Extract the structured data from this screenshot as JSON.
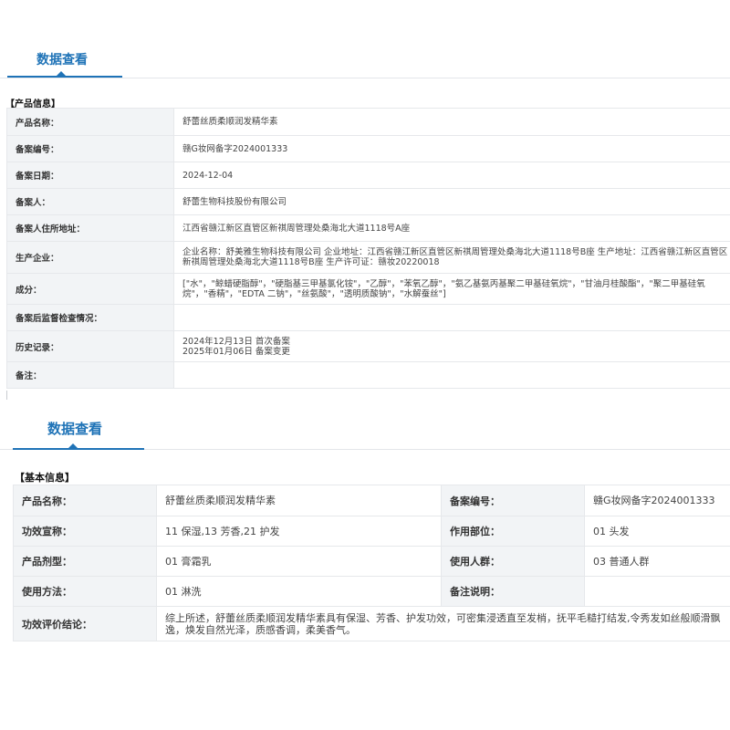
{
  "panel1": {
    "tab_label": "数据查看",
    "section_title": "【产品信息】",
    "rows": [
      {
        "label": "产品名称：",
        "value": "舒蕾丝质柔顺润发精华素"
      },
      {
        "label": "备案编号：",
        "value": "赣G妆网备字2024001333"
      },
      {
        "label": "备案日期：",
        "value": "2024-12-04"
      },
      {
        "label": "备案人：",
        "value": "舒蕾生物科技股份有限公司"
      },
      {
        "label": "备案人住所地址：",
        "value": "江西省赣江新区直管区新祺周管理处桑海北大道1118号A座"
      },
      {
        "label": "生产企业：",
        "value": "企业名称：舒美雅生物科技有限公司 企业地址：江西省赣江新区直管区新祺周管理处桑海北大道1118号B座 生产地址：江西省赣江新区直管区新祺周管理处桑海北大道1118号B座 生产许可证：赣妆20220018"
      },
      {
        "label": "成分：",
        "value": "[\"水\"，\"鲸蜡硬脂醇\"，\"硬脂基三甲基氯化铵\"，\"乙醇\"，\"苯氧乙醇\"，\"氨乙基氨丙基聚二甲基硅氧烷\"，\"甘油月桂酸酯\"，\"聚二甲基硅氧烷\"，\"香精\"，\"EDTA 二钠\"，\"丝氨酸\"，\"透明质酸钠\"，\"水解蚕丝\"]"
      },
      {
        "label": "备案后监督检查情况：",
        "value": ""
      },
      {
        "label": "历史记录：",
        "value_lines": [
          "2024年12月13日 首次备案",
          "2025年01月06日 备案变更"
        ]
      },
      {
        "label": "备注：",
        "value": ""
      }
    ]
  },
  "panel2": {
    "tab_label": "数据查看",
    "section_title": "【基本信息】",
    "rows": [
      {
        "label1": "产品名称：",
        "value1": "舒蕾丝质柔顺润发精华素",
        "label2": "备案编号：",
        "value2": "赣G妆网备字2024001333"
      },
      {
        "label1": "功效宣称：",
        "value1": "11 保湿,13 芳香,21 护发",
        "label2": "作用部位：",
        "value2": "01 头发"
      },
      {
        "label1": "产品剂型：",
        "value1": "01 膏霜乳",
        "label2": "使用人群：",
        "value2": "03 普通人群"
      },
      {
        "label1": "使用方法：",
        "value1": "01 淋洗",
        "label2": "备注说明：",
        "value2": ""
      }
    ],
    "conclusion_label": "功效评价结论：",
    "conclusion_value": "综上所述，舒蕾丝质柔顺润发精华素具有保湿、芳香、护发功效，可密集浸透直至发梢，抚平毛糙打结发,令秀发如丝般顺滑飘逸，焕发自然光泽，质感香调，柔美香气。"
  },
  "colors": {
    "accent": "#1f73b7",
    "label_bg": "#f2f4f6",
    "border": "#e6e8eb"
  }
}
